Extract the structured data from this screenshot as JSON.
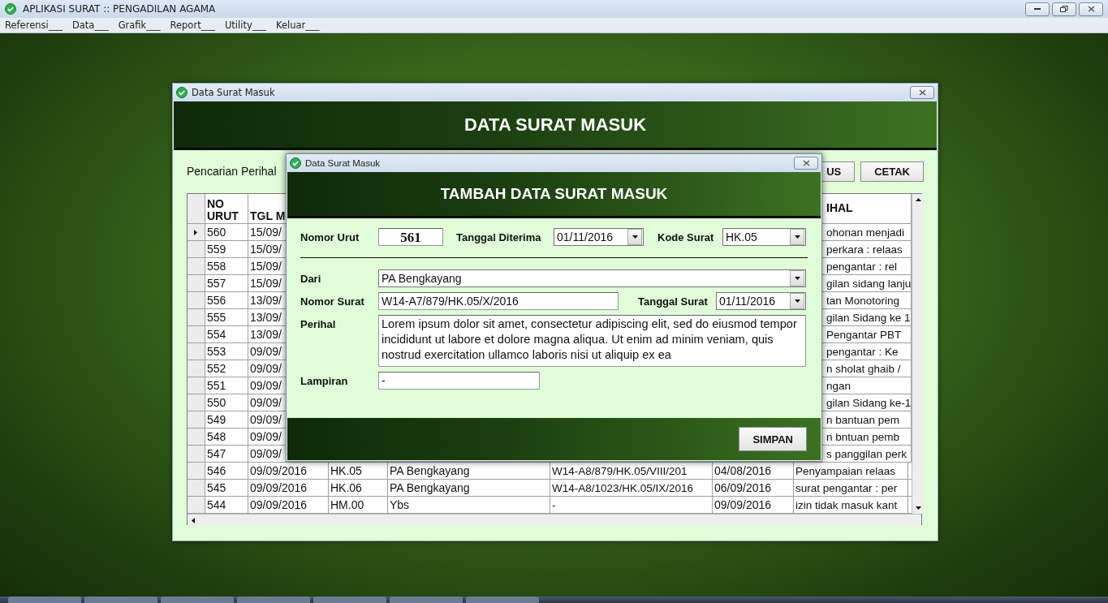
{
  "app": {
    "title": "APLIKASI SURAT :: PENGADILAN AGAMA",
    "menu": [
      "Referensi___",
      "Data___",
      "Grafik___",
      "Report___",
      "Utility___",
      "Keluar___"
    ]
  },
  "main_window": {
    "title": "Data Surat Masuk",
    "heading": "DATA SURAT MASUK",
    "search_label": "Pencarian Perihal",
    "buttons": [
      "US",
      "CETAK"
    ],
    "table": {
      "columns": [
        "NO URUT",
        "TGL M",
        "IHAL"
      ],
      "rows": [
        {
          "kind": "partial",
          "selected": true,
          "cells": [
            "560",
            "15/09/",
            "ohonan menjadi"
          ]
        },
        {
          "kind": "partial",
          "selected": false,
          "cells": [
            "559",
            "15/09/",
            "perkara : relaas"
          ]
        },
        {
          "kind": "partial",
          "selected": false,
          "cells": [
            "558",
            "15/09/",
            "pengantar : rel"
          ]
        },
        {
          "kind": "partial",
          "selected": false,
          "cells": [
            "557",
            "15/09/",
            "gilan sidang lanju"
          ]
        },
        {
          "kind": "partial",
          "selected": false,
          "cells": [
            "556",
            "13/09/",
            "tan Monotoring"
          ]
        },
        {
          "kind": "partial",
          "selected": false,
          "cells": [
            "555",
            "13/09/",
            "gilan Sidang ke 1"
          ]
        },
        {
          "kind": "partial",
          "selected": false,
          "cells": [
            "554",
            "13/09/",
            "Pengantar PBT"
          ]
        },
        {
          "kind": "partial",
          "selected": false,
          "cells": [
            "553",
            "09/09/",
            "pengantar : Ke"
          ]
        },
        {
          "kind": "partial",
          "selected": false,
          "cells": [
            "552",
            "09/09/",
            "n sholat ghaib /"
          ]
        },
        {
          "kind": "partial",
          "selected": false,
          "cells": [
            "551",
            "09/09/",
            "ngan"
          ]
        },
        {
          "kind": "partial",
          "selected": false,
          "cells": [
            "550",
            "09/09/",
            "gilan Sidang ke-1"
          ]
        },
        {
          "kind": "partial",
          "selected": false,
          "cells": [
            "549",
            "09/09/",
            "n bantuan pem"
          ]
        },
        {
          "kind": "partial",
          "selected": false,
          "cells": [
            "548",
            "09/09/",
            "n bntuan pemb"
          ]
        },
        {
          "kind": "partial",
          "selected": false,
          "cells": [
            "547",
            "09/09/",
            "s panggilan perk"
          ]
        },
        {
          "kind": "full",
          "selected": false,
          "cells": [
            "546",
            "09/09/2016",
            "HK.05",
            "PA Bengkayang",
            "W14-A8/879/HK.05/VIII/201",
            "04/08/2016",
            "Penyampaian relaas"
          ]
        },
        {
          "kind": "full",
          "selected": false,
          "cells": [
            "545",
            "09/09/2016",
            "HK.06",
            "PA Bengkayang",
            "W14-A8/1023/HK.05/IX/2016",
            "06/09/2016",
            "surat pengantar : per"
          ]
        },
        {
          "kind": "full",
          "selected": false,
          "cells": [
            "544",
            "09/09/2016",
            "HM.00",
            "Ybs",
            "-",
            "09/09/2016",
            "izin tidak masuk kant"
          ]
        }
      ]
    }
  },
  "dialog": {
    "title": "Data Surat Masuk",
    "heading": "TAMBAH DATA SURAT MASUK",
    "nomor_urut": {
      "label": "Nomor Urut",
      "value": "561"
    },
    "tanggal_diterima": {
      "label": "Tanggal Diterima",
      "value": "01/11/2016"
    },
    "kode_surat": {
      "label": "Kode Surat",
      "value": "HK.05"
    },
    "dari": {
      "label": "Dari",
      "value": "PA Bengkayang"
    },
    "nomor_surat": {
      "label": "Nomor Surat",
      "value": "W14-A7/879/HK.05/X/2016"
    },
    "tanggal_surat": {
      "label": "Tanggal Surat",
      "value": "01/11/2016"
    },
    "perihal": {
      "label": "Perihal",
      "value": "Lorem ipsum dolor sit amet, consectetur adipiscing elit, sed do eiusmod tempor incididunt ut labore et dolore magna aliqua. Ut enim ad minim veniam, quis nostrud exercitation ullamco laboris nisi ut aliquip ex ea"
    },
    "lampiran": {
      "label": "Lampiran",
      "value": "-"
    },
    "button": "SIMPAN"
  }
}
